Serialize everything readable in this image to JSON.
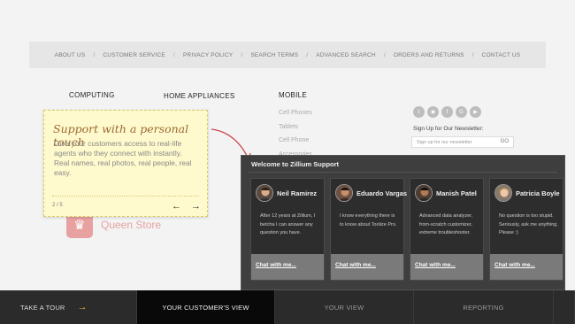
{
  "footer_nav": [
    "ABOUT US",
    "CUSTOMER SERVICE",
    "PRIVACY POLICY",
    "SEARCH TERMS",
    "ADVANCED SEARCH",
    "ORDERS AND RETURNS",
    "CONTACT US"
  ],
  "columns": {
    "computing": {
      "heading": "COMPUTING"
    },
    "home": {
      "heading": "HOME APPLIANCES"
    },
    "mobile": {
      "heading": "MOBILE",
      "links": [
        "Cell Phones",
        "Tablets",
        "Cell Phone",
        "Accessories"
      ]
    }
  },
  "social_icons": [
    "twitter-icon",
    "rss-icon",
    "facebook-icon",
    "google-plus-icon",
    "youtube-icon"
  ],
  "newsletter": {
    "label": "Sign Up for Our Newsletter:",
    "placeholder": "Sign up for our newsletter",
    "go": "GO"
  },
  "store": {
    "name": "Queen Store",
    "logo_icon": "crown-icon",
    "accent": "#e7a1a1"
  },
  "tooltip": {
    "title": "Support with a personal touch",
    "body": "Give your customers access to real-life agents who they connect with instantly. Real names, real photos, real people, real easy.",
    "counter": "2 / 5",
    "prev": "←",
    "next": "→"
  },
  "widget": {
    "title": "Welcome to Zillium Support",
    "agents": [
      {
        "name": "Neil Ramirez",
        "bio": "After 12 years at Zillium, I betcha I can answer any question you have.",
        "chat": "Chat with me..."
      },
      {
        "name": "Eduardo Vargas",
        "bio": "I know everything there is to know about Toolize Pro.",
        "chat": "Chat with me..."
      },
      {
        "name": "Manish Patel",
        "bio": "Advanced data analyzer, from-scratch customizer, extreme troubleshooter.",
        "chat": "Chat with me..."
      },
      {
        "name": "Patricia Boyle",
        "bio": "No question is too stupid. Seriously, ask me anything. Please :)",
        "chat": "Chat with me..."
      }
    ]
  },
  "tabs": {
    "tour": "TAKE A TOUR",
    "tour_arrow": "→",
    "customer": "YOUR CUSTOMER'S VIEW",
    "your": "YOUR VIEW",
    "reporting": "REPORTING"
  },
  "colors": {
    "tour_arrow": "#e0b73c",
    "active_tab": "#090909",
    "tooltip_bg": "#fffacd"
  }
}
